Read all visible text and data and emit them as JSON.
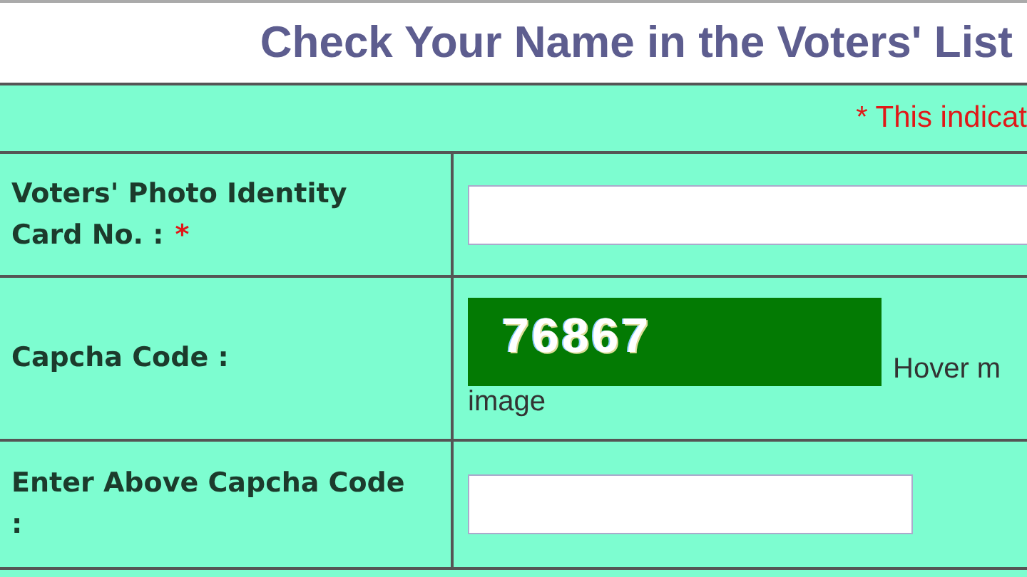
{
  "title": "Check Your Name in the Voters' List",
  "note": "* This indicat",
  "rows": [
    {
      "kind": "input",
      "label": "Voters' Photo Identity Card No. :",
      "required_mark": "*"
    },
    {
      "kind": "captcha",
      "label": "Capcha Code :",
      "code": "76867",
      "hint": "Hover m",
      "hint_more": "image"
    },
    {
      "kind": "input_short",
      "label": "Enter Above Capcha Code :"
    }
  ]
}
